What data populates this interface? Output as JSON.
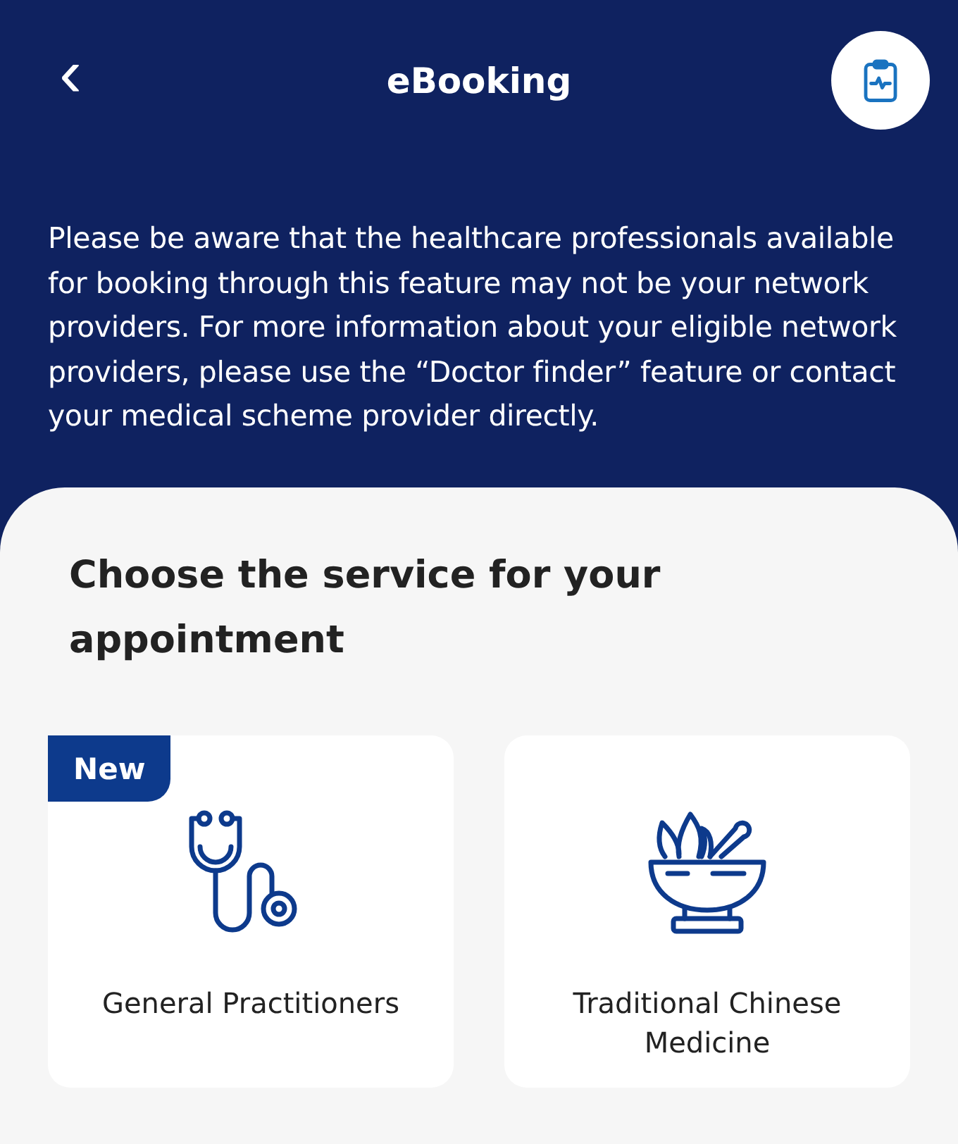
{
  "header": {
    "back": "‹",
    "title": "eBooking"
  },
  "notice": "Please be aware that the healthcare professionals available for booking through this feature may not be your network providers. For more information about your eligible network providers, please use the “Doctor finder” feature or contact your medical scheme provider directly.",
  "section_title": "Choose the service for your appointment",
  "services": [
    {
      "kind": "stethoscope",
      "label": "General Practitioners",
      "badge": "New"
    },
    {
      "kind": "mortar",
      "label": "Traditional Chinese Medicine"
    }
  ]
}
